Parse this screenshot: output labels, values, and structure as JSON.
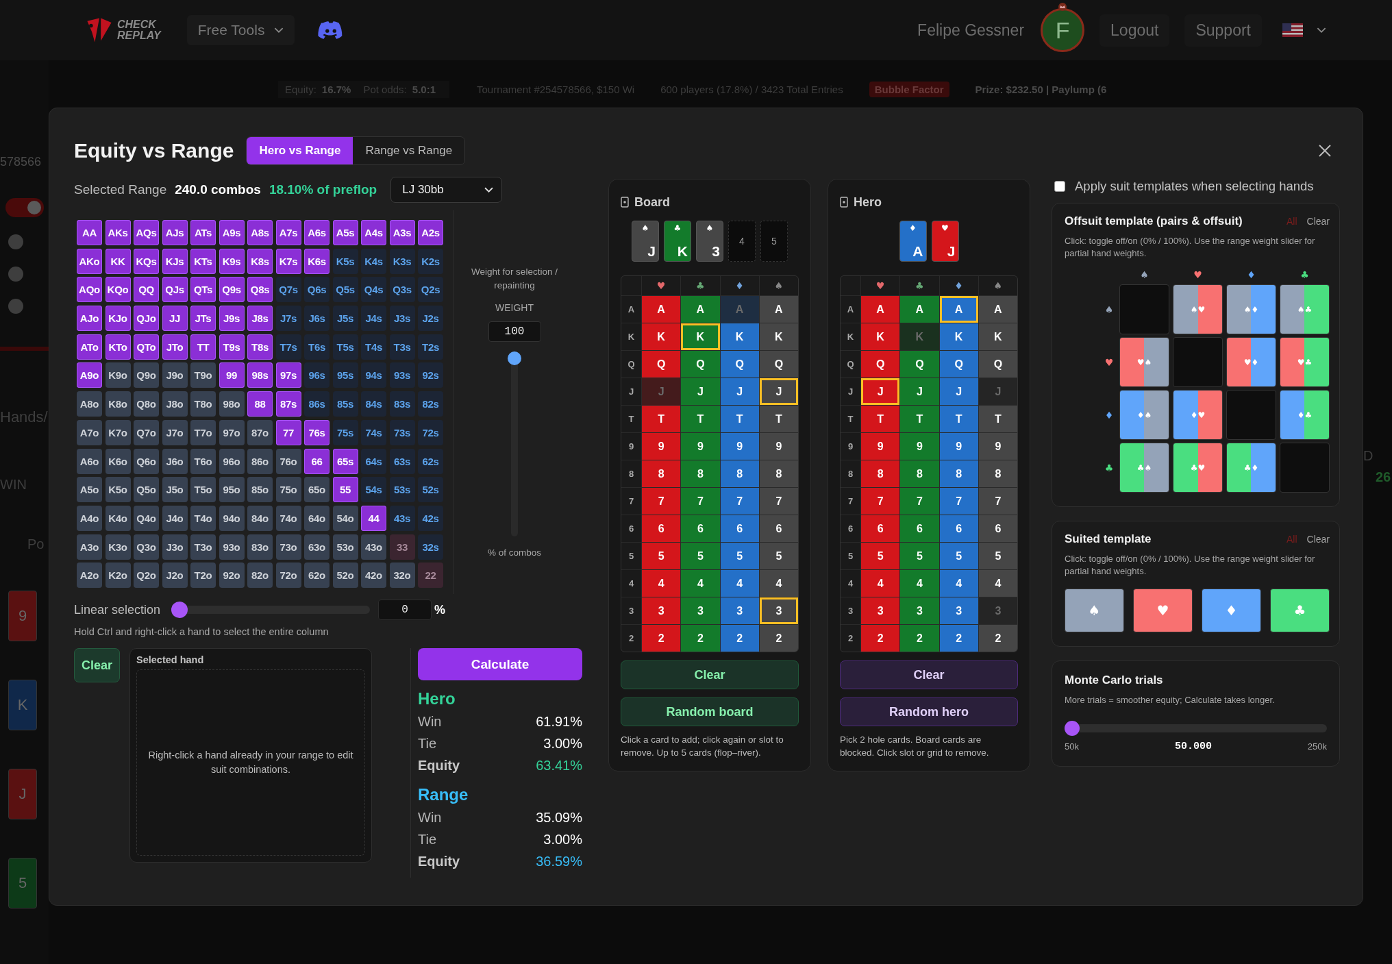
{
  "nav": {
    "logo_lines": [
      "CHECK",
      "REPLAY"
    ],
    "menu": "Free Tools",
    "user": "Felipe Gessner",
    "avatar": "F",
    "links": [
      "Logout",
      "Support"
    ]
  },
  "background": {
    "left": {
      "number": "578566",
      "toggle": {
        "on": true
      },
      "label": "Hands/",
      "badge": "WIN",
      "text": "Po",
      "cards": [
        {
          "rank": "9",
          "color": "#5a1111"
        },
        {
          "rank": "K",
          "color": "#10284a"
        },
        {
          "rank": "J",
          "color": "#5a1111"
        },
        {
          "rank": "5",
          "color": "#0d3a18"
        }
      ]
    },
    "stats": [
      {
        "label": "Equity:",
        "value": "16.7%"
      },
      {
        "label": "Pot odds:",
        "value": "5.0:1"
      }
    ],
    "tournament": "Tournament #254578566, $150 Wi",
    "entries": "600 players (17.8%) / 3423 Total Entries",
    "badge": "Bubble Factor",
    "prize": "Prize: $232.50 | Paylump (6",
    "right": {
      "letter": "D",
      "value": "26"
    }
  },
  "title": "Equity vs Range",
  "tabs": [
    {
      "label": "Hero vs Range",
      "selected": true
    },
    {
      "label": "Range vs Range",
      "selected": false
    }
  ],
  "summary": {
    "label": "Selected Range",
    "combos": "240.0 combos",
    "percent": "18.10% of preflop"
  },
  "preset": {
    "value": "LJ 30bb"
  },
  "range_grid": {
    "rows": [
      [
        {
          "label": "AA",
          "selected": true
        },
        {
          "label": "AKs",
          "selected": true
        },
        {
          "label": "AQs",
          "selected": true
        },
        {
          "label": "AJs",
          "selected": true
        },
        {
          "label": "ATs",
          "selected": true
        },
        {
          "label": "A9s",
          "selected": true
        },
        {
          "label": "A8s",
          "selected": true
        },
        {
          "label": "A7s",
          "selected": true
        },
        {
          "label": "A6s",
          "selected": true
        },
        {
          "label": "A5s",
          "selected": true
        },
        {
          "label": "A4s",
          "selected": true
        },
        {
          "label": "A3s",
          "selected": true
        },
        {
          "label": "A2s",
          "selected": true
        }
      ],
      [
        {
          "label": "AKo",
          "selected": true
        },
        {
          "label": "KK",
          "selected": true
        },
        {
          "label": "KQs",
          "selected": true
        },
        {
          "label": "KJs",
          "selected": true
        },
        {
          "label": "KTs",
          "selected": true
        },
        {
          "label": "K9s",
          "selected": true
        },
        {
          "label": "K8s",
          "selected": true
        },
        {
          "label": "K7s",
          "selected": true
        },
        {
          "label": "K6s",
          "selected": true
        },
        {
          "label": "K5s",
          "selected": false
        },
        {
          "label": "K4s",
          "selected": false
        },
        {
          "label": "K3s",
          "selected": false
        },
        {
          "label": "K2s",
          "selected": false
        }
      ],
      [
        {
          "label": "AQo",
          "selected": true
        },
        {
          "label": "KQo",
          "selected": true
        },
        {
          "label": "QQ",
          "selected": true
        },
        {
          "label": "QJs",
          "selected": true
        },
        {
          "label": "QTs",
          "selected": true
        },
        {
          "label": "Q9s",
          "selected": true
        },
        {
          "label": "Q8s",
          "selected": true
        },
        {
          "label": "Q7s",
          "selected": false
        },
        {
          "label": "Q6s",
          "selected": false
        },
        {
          "label": "Q5s",
          "selected": false
        },
        {
          "label": "Q4s",
          "selected": false
        },
        {
          "label": "Q3s",
          "selected": false
        },
        {
          "label": "Q2s",
          "selected": false
        }
      ],
      [
        {
          "label": "AJo",
          "selected": true
        },
        {
          "label": "KJo",
          "selected": true
        },
        {
          "label": "QJo",
          "selected": true
        },
        {
          "label": "JJ",
          "selected": true
        },
        {
          "label": "JTs",
          "selected": true
        },
        {
          "label": "J9s",
          "selected": true
        },
        {
          "label": "J8s",
          "selected": true
        },
        {
          "label": "J7s",
          "selected": false
        },
        {
          "label": "J6s",
          "selected": false
        },
        {
          "label": "J5s",
          "selected": false
        },
        {
          "label": "J4s",
          "selected": false
        },
        {
          "label": "J3s",
          "selected": false
        },
        {
          "label": "J2s",
          "selected": false
        }
      ],
      [
        {
          "label": "ATo",
          "selected": true
        },
        {
          "label": "KTo",
          "selected": true
        },
        {
          "label": "QTo",
          "selected": true
        },
        {
          "label": "JTo",
          "selected": true
        },
        {
          "label": "TT",
          "selected": true
        },
        {
          "label": "T9s",
          "selected": true
        },
        {
          "label": "T8s",
          "selected": true
        },
        {
          "label": "T7s",
          "selected": false
        },
        {
          "label": "T6s",
          "selected": false
        },
        {
          "label": "T5s",
          "selected": false
        },
        {
          "label": "T4s",
          "selected": false
        },
        {
          "label": "T3s",
          "selected": false
        },
        {
          "label": "T2s",
          "selected": false
        }
      ],
      [
        {
          "label": "A9o",
          "selected": true
        },
        {
          "label": "K9o",
          "selected": false
        },
        {
          "label": "Q9o",
          "selected": false
        },
        {
          "label": "J9o",
          "selected": false
        },
        {
          "label": "T9o",
          "selected": false
        },
        {
          "label": "99",
          "selected": true
        },
        {
          "label": "98s",
          "selected": true
        },
        {
          "label": "97s",
          "selected": true
        },
        {
          "label": "96s",
          "selected": false
        },
        {
          "label": "95s",
          "selected": false
        },
        {
          "label": "94s",
          "selected": false
        },
        {
          "label": "93s",
          "selected": false
        },
        {
          "label": "92s",
          "selected": false
        }
      ],
      [
        {
          "label": "A8o",
          "selected": false
        },
        {
          "label": "K8o",
          "selected": false
        },
        {
          "label": "Q8o",
          "selected": false
        },
        {
          "label": "J8o",
          "selected": false
        },
        {
          "label": "T8o",
          "selected": false
        },
        {
          "label": "98o",
          "selected": false
        },
        {
          "label": "88",
          "selected": true
        },
        {
          "label": "87s",
          "selected": true
        },
        {
          "label": "86s",
          "selected": false
        },
        {
          "label": "85s",
          "selected": false
        },
        {
          "label": "84s",
          "selected": false
        },
        {
          "label": "83s",
          "selected": false
        },
        {
          "label": "82s",
          "selected": false
        }
      ],
      [
        {
          "label": "A7o",
          "selected": false
        },
        {
          "label": "K7o",
          "selected": false
        },
        {
          "label": "Q7o",
          "selected": false
        },
        {
          "label": "J7o",
          "selected": false
        },
        {
          "label": "T7o",
          "selected": false
        },
        {
          "label": "97o",
          "selected": false
        },
        {
          "label": "87o",
          "selected": false
        },
        {
          "label": "77",
          "selected": true
        },
        {
          "label": "76s",
          "selected": true
        },
        {
          "label": "75s",
          "selected": false
        },
        {
          "label": "74s",
          "selected": false
        },
        {
          "label": "73s",
          "selected": false
        },
        {
          "label": "72s",
          "selected": false
        }
      ],
      [
        {
          "label": "A6o",
          "selected": false
        },
        {
          "label": "K6o",
          "selected": false
        },
        {
          "label": "Q6o",
          "selected": false
        },
        {
          "label": "J6o",
          "selected": false
        },
        {
          "label": "T6o",
          "selected": false
        },
        {
          "label": "96o",
          "selected": false
        },
        {
          "label": "86o",
          "selected": false
        },
        {
          "label": "76o",
          "selected": false
        },
        {
          "label": "66",
          "selected": true
        },
        {
          "label": "65s",
          "selected": true
        },
        {
          "label": "64s",
          "selected": false
        },
        {
          "label": "63s",
          "selected": false
        },
        {
          "label": "62s",
          "selected": false
        }
      ],
      [
        {
          "label": "A5o",
          "selected": false
        },
        {
          "label": "K5o",
          "selected": false
        },
        {
          "label": "Q5o",
          "selected": false
        },
        {
          "label": "J5o",
          "selected": false
        },
        {
          "label": "T5o",
          "selected": false
        },
        {
          "label": "95o",
          "selected": false
        },
        {
          "label": "85o",
          "selected": false
        },
        {
          "label": "75o",
          "selected": false
        },
        {
          "label": "65o",
          "selected": false
        },
        {
          "label": "55",
          "selected": true
        },
        {
          "label": "54s",
          "selected": false
        },
        {
          "label": "53s",
          "selected": false
        },
        {
          "label": "52s",
          "selected": false
        }
      ],
      [
        {
          "label": "A4o",
          "selected": false
        },
        {
          "label": "K4o",
          "selected": false
        },
        {
          "label": "Q4o",
          "selected": false
        },
        {
          "label": "J4o",
          "selected": false
        },
        {
          "label": "T4o",
          "selected": false
        },
        {
          "label": "94o",
          "selected": false
        },
        {
          "label": "84o",
          "selected": false
        },
        {
          "label": "74o",
          "selected": false
        },
        {
          "label": "64o",
          "selected": false
        },
        {
          "label": "54o",
          "selected": false
        },
        {
          "label": "44",
          "selected": true
        },
        {
          "label": "43s",
          "selected": false
        },
        {
          "label": "42s",
          "selected": false
        }
      ],
      [
        {
          "label": "A3o",
          "selected": false
        },
        {
          "label": "K3o",
          "selected": false
        },
        {
          "label": "Q3o",
          "selected": false
        },
        {
          "label": "J3o",
          "selected": false
        },
        {
          "label": "T3o",
          "selected": false
        },
        {
          "label": "93o",
          "selected": false
        },
        {
          "label": "83o",
          "selected": false
        },
        {
          "label": "73o",
          "selected": false
        },
        {
          "label": "63o",
          "selected": false
        },
        {
          "label": "53o",
          "selected": false
        },
        {
          "label": "43o",
          "selected": false
        },
        {
          "label": "33",
          "selected": false
        },
        {
          "label": "32s",
          "selected": false
        }
      ],
      [
        {
          "label": "A2o",
          "selected": false
        },
        {
          "label": "K2o",
          "selected": false
        },
        {
          "label": "Q2o",
          "selected": false
        },
        {
          "label": "J2o",
          "selected": false
        },
        {
          "label": "T2o",
          "selected": false
        },
        {
          "label": "92o",
          "selected": false
        },
        {
          "label": "82o",
          "selected": false
        },
        {
          "label": "72o",
          "selected": false
        },
        {
          "label": "62o",
          "selected": false
        },
        {
          "label": "52o",
          "selected": false
        },
        {
          "label": "42o",
          "selected": false
        },
        {
          "label": "32o",
          "selected": false
        },
        {
          "label": "22",
          "selected": false
        }
      ]
    ]
  },
  "weight": {
    "caption": "Weight for selection / repainting",
    "label": "WEIGHT",
    "value": "100",
    "level": 1,
    "footer": "% of combos"
  },
  "linear": {
    "label": "Linear selection",
    "level": 0,
    "value": "0",
    "unit": "%",
    "hint": "Hold Ctrl and right-click a hand to select the entire column"
  },
  "clear_button": "Clear",
  "selected_hand": {
    "title": "Selected hand",
    "message": "Right-click a hand already in your range to edit suit combinations."
  },
  "calculate_button": "Calculate",
  "results": [
    {
      "name": "Hero",
      "color": "#34d399",
      "rows": [
        {
          "kind": "stat",
          "label": "Win",
          "value": "61.91%"
        },
        {
          "kind": "stat",
          "label": "Tie",
          "value": "3.00%"
        },
        {
          "kind": "equity",
          "label": "Equity",
          "value": "63.41%"
        }
      ]
    },
    {
      "name": "Range",
      "color": "#38bdf8",
      "rows": [
        {
          "kind": "stat",
          "label": "Win",
          "value": "35.09%"
        },
        {
          "kind": "stat",
          "label": "Tie",
          "value": "3.00%"
        },
        {
          "kind": "equity",
          "label": "Equity",
          "value": "36.59%"
        }
      ]
    }
  ],
  "panels": [
    {
      "kind": "board",
      "title": "Board",
      "slots": [
        {
          "kind": "card",
          "rank": "J",
          "suit": "♠",
          "color": "#464646"
        },
        {
          "kind": "card",
          "rank": "K",
          "suit": "♣",
          "color": "#137b2b"
        },
        {
          "kind": "card",
          "rank": "3",
          "suit": "♠",
          "color": "#464646"
        },
        {
          "kind": "empty",
          "label": "4"
        },
        {
          "kind": "empty",
          "label": "5"
        }
      ],
      "suits": [
        {
          "symbol": "♥",
          "color": "#d4161b"
        },
        {
          "symbol": "♣",
          "color": "#137b2b"
        },
        {
          "symbol": "♦",
          "color": "#2470c8"
        },
        {
          "symbol": "♠",
          "color": "#464646"
        }
      ],
      "rows": [
        {
          "rank": "A",
          "cells": [
            {
              "label": "A",
              "selected": false,
              "blocked": false
            },
            {
              "label": "A",
              "selected": false,
              "blocked": false
            },
            {
              "label": "A",
              "selected": false,
              "blocked": true
            },
            {
              "label": "A",
              "selected": false,
              "blocked": false
            }
          ]
        },
        {
          "rank": "K",
          "cells": [
            {
              "label": "K",
              "selected": false,
              "blocked": false
            },
            {
              "label": "K",
              "selected": true,
              "blocked": false
            },
            {
              "label": "K",
              "selected": false,
              "blocked": false
            },
            {
              "label": "K",
              "selected": false,
              "blocked": false
            }
          ]
        },
        {
          "rank": "Q",
          "cells": [
            {
              "label": "Q",
              "selected": false,
              "blocked": false
            },
            {
              "label": "Q",
              "selected": false,
              "blocked": false
            },
            {
              "label": "Q",
              "selected": false,
              "blocked": false
            },
            {
              "label": "Q",
              "selected": false,
              "blocked": false
            }
          ]
        },
        {
          "rank": "J",
          "cells": [
            {
              "label": "J",
              "selected": false,
              "blocked": true
            },
            {
              "label": "J",
              "selected": false,
              "blocked": false
            },
            {
              "label": "J",
              "selected": false,
              "blocked": false
            },
            {
              "label": "J",
              "selected": true,
              "blocked": false
            }
          ]
        },
        {
          "rank": "T",
          "cells": [
            {
              "label": "T",
              "selected": false,
              "blocked": false
            },
            {
              "label": "T",
              "selected": false,
              "blocked": false
            },
            {
              "label": "T",
              "selected": false,
              "blocked": false
            },
            {
              "label": "T",
              "selected": false,
              "blocked": false
            }
          ]
        },
        {
          "rank": "9",
          "cells": [
            {
              "label": "9",
              "selected": false,
              "blocked": false
            },
            {
              "label": "9",
              "selected": false,
              "blocked": false
            },
            {
              "label": "9",
              "selected": false,
              "blocked": false
            },
            {
              "label": "9",
              "selected": false,
              "blocked": false
            }
          ]
        },
        {
          "rank": "8",
          "cells": [
            {
              "label": "8",
              "selected": false,
              "blocked": false
            },
            {
              "label": "8",
              "selected": false,
              "blocked": false
            },
            {
              "label": "8",
              "selected": false,
              "blocked": false
            },
            {
              "label": "8",
              "selected": false,
              "blocked": false
            }
          ]
        },
        {
          "rank": "7",
          "cells": [
            {
              "label": "7",
              "selected": false,
              "blocked": false
            },
            {
              "label": "7",
              "selected": false,
              "blocked": false
            },
            {
              "label": "7",
              "selected": false,
              "blocked": false
            },
            {
              "label": "7",
              "selected": false,
              "blocked": false
            }
          ]
        },
        {
          "rank": "6",
          "cells": [
            {
              "label": "6",
              "selected": false,
              "blocked": false
            },
            {
              "label": "6",
              "selected": false,
              "blocked": false
            },
            {
              "label": "6",
              "selected": false,
              "blocked": false
            },
            {
              "label": "6",
              "selected": false,
              "blocked": false
            }
          ]
        },
        {
          "rank": "5",
          "cells": [
            {
              "label": "5",
              "selected": false,
              "blocked": false
            },
            {
              "label": "5",
              "selected": false,
              "blocked": false
            },
            {
              "label": "5",
              "selected": false,
              "blocked": false
            },
            {
              "label": "5",
              "selected": false,
              "blocked": false
            }
          ]
        },
        {
          "rank": "4",
          "cells": [
            {
              "label": "4",
              "selected": false,
              "blocked": false
            },
            {
              "label": "4",
              "selected": false,
              "blocked": false
            },
            {
              "label": "4",
              "selected": false,
              "blocked": false
            },
            {
              "label": "4",
              "selected": false,
              "blocked": false
            }
          ]
        },
        {
          "rank": "3",
          "cells": [
            {
              "label": "3",
              "selected": false,
              "blocked": false
            },
            {
              "label": "3",
              "selected": false,
              "blocked": false
            },
            {
              "label": "3",
              "selected": false,
              "blocked": false
            },
            {
              "label": "3",
              "selected": true,
              "blocked": false
            }
          ]
        },
        {
          "rank": "2",
          "cells": [
            {
              "label": "2",
              "selected": false,
              "blocked": false
            },
            {
              "label": "2",
              "selected": false,
              "blocked": false
            },
            {
              "label": "2",
              "selected": false,
              "blocked": false
            },
            {
              "label": "2",
              "selected": false,
              "blocked": false
            }
          ]
        }
      ],
      "buttons": [
        "Clear",
        "Random board"
      ],
      "hint": "Click a card to add; click again or slot to remove. Up to 5 cards (flop–river)."
    },
    {
      "kind": "hero",
      "title": "Hero",
      "slots": [
        {
          "kind": "card",
          "rank": "A",
          "suit": "♦",
          "color": "#2470c8"
        },
        {
          "kind": "card",
          "rank": "J",
          "suit": "♥",
          "color": "#d4161b"
        }
      ],
      "suits": [
        {
          "symbol": "♥",
          "color": "#d4161b"
        },
        {
          "symbol": "♣",
          "color": "#137b2b"
        },
        {
          "symbol": "♦",
          "color": "#2470c8"
        },
        {
          "symbol": "♠",
          "color": "#464646"
        }
      ],
      "rows": [
        {
          "rank": "A",
          "cells": [
            {
              "label": "A",
              "selected": false,
              "blocked": false
            },
            {
              "label": "A",
              "selected": false,
              "blocked": false
            },
            {
              "label": "A",
              "selected": true,
              "blocked": false
            },
            {
              "label": "A",
              "selected": false,
              "blocked": false
            }
          ]
        },
        {
          "rank": "K",
          "cells": [
            {
              "label": "K",
              "selected": false,
              "blocked": false
            },
            {
              "label": "K",
              "selected": false,
              "blocked": true
            },
            {
              "label": "K",
              "selected": false,
              "blocked": false
            },
            {
              "label": "K",
              "selected": false,
              "blocked": false
            }
          ]
        },
        {
          "rank": "Q",
          "cells": [
            {
              "label": "Q",
              "selected": false,
              "blocked": false
            },
            {
              "label": "Q",
              "selected": false,
              "blocked": false
            },
            {
              "label": "Q",
              "selected": false,
              "blocked": false
            },
            {
              "label": "Q",
              "selected": false,
              "blocked": false
            }
          ]
        },
        {
          "rank": "J",
          "cells": [
            {
              "label": "J",
              "selected": true,
              "blocked": false
            },
            {
              "label": "J",
              "selected": false,
              "blocked": false
            },
            {
              "label": "J",
              "selected": false,
              "blocked": false
            },
            {
              "label": "J",
              "selected": false,
              "blocked": true
            }
          ]
        },
        {
          "rank": "T",
          "cells": [
            {
              "label": "T",
              "selected": false,
              "blocked": false
            },
            {
              "label": "T",
              "selected": false,
              "blocked": false
            },
            {
              "label": "T",
              "selected": false,
              "blocked": false
            },
            {
              "label": "T",
              "selected": false,
              "blocked": false
            }
          ]
        },
        {
          "rank": "9",
          "cells": [
            {
              "label": "9",
              "selected": false,
              "blocked": false
            },
            {
              "label": "9",
              "selected": false,
              "blocked": false
            },
            {
              "label": "9",
              "selected": false,
              "blocked": false
            },
            {
              "label": "9",
              "selected": false,
              "blocked": false
            }
          ]
        },
        {
          "rank": "8",
          "cells": [
            {
              "label": "8",
              "selected": false,
              "blocked": false
            },
            {
              "label": "8",
              "selected": false,
              "blocked": false
            },
            {
              "label": "8",
              "selected": false,
              "blocked": false
            },
            {
              "label": "8",
              "selected": false,
              "blocked": false
            }
          ]
        },
        {
          "rank": "7",
          "cells": [
            {
              "label": "7",
              "selected": false,
              "blocked": false
            },
            {
              "label": "7",
              "selected": false,
              "blocked": false
            },
            {
              "label": "7",
              "selected": false,
              "blocked": false
            },
            {
              "label": "7",
              "selected": false,
              "blocked": false
            }
          ]
        },
        {
          "rank": "6",
          "cells": [
            {
              "label": "6",
              "selected": false,
              "blocked": false
            },
            {
              "label": "6",
              "selected": false,
              "blocked": false
            },
            {
              "label": "6",
              "selected": false,
              "blocked": false
            },
            {
              "label": "6",
              "selected": false,
              "blocked": false
            }
          ]
        },
        {
          "rank": "5",
          "cells": [
            {
              "label": "5",
              "selected": false,
              "blocked": false
            },
            {
              "label": "5",
              "selected": false,
              "blocked": false
            },
            {
              "label": "5",
              "selected": false,
              "blocked": false
            },
            {
              "label": "5",
              "selected": false,
              "blocked": false
            }
          ]
        },
        {
          "rank": "4",
          "cells": [
            {
              "label": "4",
              "selected": false,
              "blocked": false
            },
            {
              "label": "4",
              "selected": false,
              "blocked": false
            },
            {
              "label": "4",
              "selected": false,
              "blocked": false
            },
            {
              "label": "4",
              "selected": false,
              "blocked": false
            }
          ]
        },
        {
          "rank": "3",
          "cells": [
            {
              "label": "3",
              "selected": false,
              "blocked": false
            },
            {
              "label": "3",
              "selected": false,
              "blocked": false
            },
            {
              "label": "3",
              "selected": false,
              "blocked": false
            },
            {
              "label": "3",
              "selected": false,
              "blocked": true
            }
          ]
        },
        {
          "rank": "2",
          "cells": [
            {
              "label": "2",
              "selected": false,
              "blocked": false
            },
            {
              "label": "2",
              "selected": false,
              "blocked": false
            },
            {
              "label": "2",
              "selected": false,
              "blocked": false
            },
            {
              "label": "2",
              "selected": false,
              "blocked": false
            }
          ]
        }
      ],
      "buttons": [
        "Clear",
        "Random hero"
      ],
      "hint": "Pick 2 hole cards. Board cards are blocked. Click slot or grid to remove."
    }
  ],
  "suit_templates": {
    "apply": {
      "label": "Apply suit templates when selecting hands",
      "checked": false
    },
    "offsuit": {
      "title": "Offsuit template (pairs & offsuit)",
      "all": "All",
      "clear": "Clear",
      "hint": "Click: toggle off/on (0% / 100%). Use the range weight slider for partial hand weights.",
      "columns": [
        {
          "symbol": "♠",
          "color": "#94a3b8"
        },
        {
          "symbol": "♥",
          "color": "#f87171"
        },
        {
          "symbol": "♦",
          "color": "#60a5fa"
        },
        {
          "symbol": "♣",
          "color": "#4ade80"
        }
      ],
      "rows": [
        {
          "symbol": "♠",
          "color": "#94a3b8",
          "cells": [
            {
              "kind": "none"
            },
            {
              "kind": "combo",
              "label": "♠♥"
            },
            {
              "kind": "combo",
              "label": "♠♦"
            },
            {
              "kind": "combo",
              "label": "♠♣"
            }
          ]
        },
        {
          "symbol": "♥",
          "color": "#f87171",
          "cells": [
            {
              "kind": "combo",
              "label": "♥♠"
            },
            {
              "kind": "none"
            },
            {
              "kind": "combo",
              "label": "♥♦"
            },
            {
              "kind": "combo",
              "label": "♥♣"
            }
          ]
        },
        {
          "symbol": "♦",
          "color": "#60a5fa",
          "cells": [
            {
              "kind": "combo",
              "label": "♦♠"
            },
            {
              "kind": "combo",
              "label": "♦♥"
            },
            {
              "kind": "none"
            },
            {
              "kind": "combo",
              "label": "♦♣"
            }
          ]
        },
        {
          "symbol": "♣",
          "color": "#4ade80",
          "cells": [
            {
              "kind": "combo",
              "label": "♣♠"
            },
            {
              "kind": "combo",
              "label": "♣♥"
            },
            {
              "kind": "combo",
              "label": "♣♦"
            },
            {
              "kind": "none"
            }
          ]
        }
      ]
    },
    "suited": {
      "title": "Suited template",
      "all": "All",
      "clear": "Clear",
      "hint": "Click: toggle off/on (0% / 100%). Use the range weight slider for partial hand weights.",
      "suits": [
        {
          "symbol": "♠",
          "color": "#94a3b8"
        },
        {
          "symbol": "♥",
          "color": "#f87171"
        },
        {
          "symbol": "♦",
          "color": "#60a5fa"
        },
        {
          "symbol": "♣",
          "color": "#4ade80"
        }
      ]
    }
  },
  "monte_carlo": {
    "title": "Monte Carlo trials",
    "hint": "More trials = smoother equity; Calculate takes longer.",
    "level": 0,
    "min": "50k",
    "value": "50.000",
    "max": "250k"
  }
}
